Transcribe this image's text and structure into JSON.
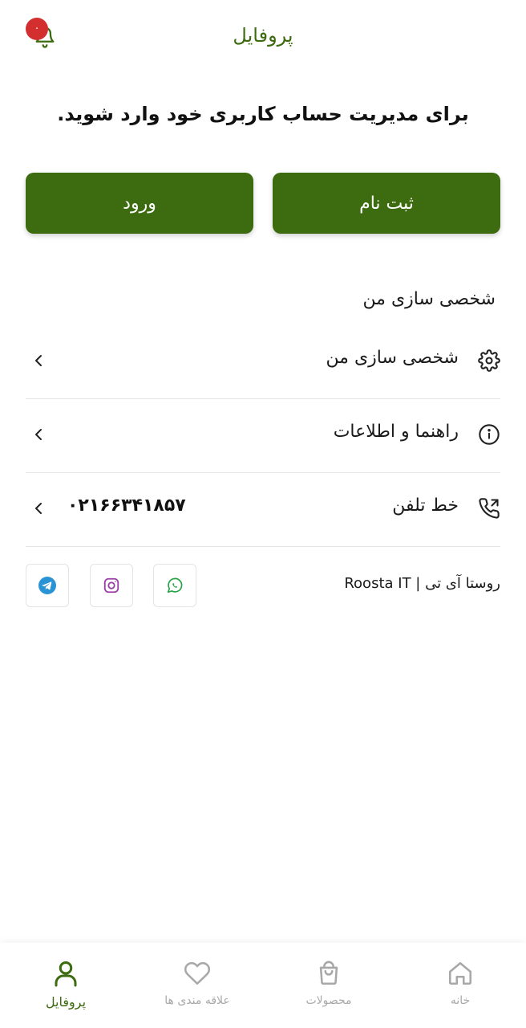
{
  "header": {
    "title": "پروفایل",
    "notification_count": "۰",
    "bell_icon": "bell-icon"
  },
  "auth": {
    "prompt": "برای مدیریت حساب کاربری خود وارد شوید.",
    "register_label": "ثبت نام",
    "login_label": "ورود"
  },
  "section": {
    "title": "شخصی سازی من"
  },
  "menu": [
    {
      "label": "شخصی سازی من",
      "icon": "gear-icon"
    },
    {
      "label": "راهنما و اطلاعات",
      "icon": "info-icon"
    },
    {
      "label": "خط تلفن",
      "icon": "phone-icon",
      "value": "۰۲۱۶۶۳۴۱۸۵۷"
    }
  ],
  "social": {
    "brand_text": "روستا آی تی | Roosta IT",
    "items": [
      {
        "name": "whatsapp",
        "icon": "whatsapp-icon",
        "color": "#25a244"
      },
      {
        "name": "instagram",
        "icon": "instagram-icon",
        "color": "#9b3ea8"
      },
      {
        "name": "telegram",
        "icon": "telegram-icon",
        "color": "#2a93d5"
      }
    ]
  },
  "bottom_nav": {
    "items": [
      {
        "label": "خانه",
        "icon": "home-icon",
        "active": false
      },
      {
        "label": "محصولات",
        "icon": "shopping-bag-icon",
        "active": false
      },
      {
        "label": "علاقه مندی ها",
        "icon": "heart-icon",
        "active": false
      },
      {
        "label": "پروفایل",
        "icon": "user-icon",
        "active": true
      }
    ]
  },
  "colors": {
    "primary": "#3d6b0f",
    "badge": "#d32f2f",
    "inactive": "#a8a8a8"
  }
}
